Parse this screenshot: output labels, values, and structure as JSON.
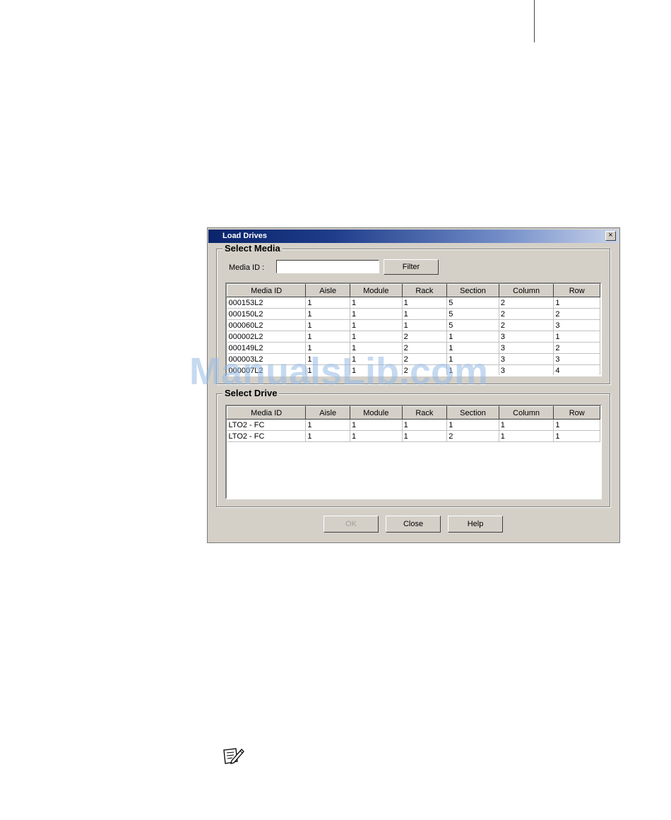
{
  "dialog": {
    "title": "Load Drives",
    "close_glyph": "×"
  },
  "media": {
    "legend": "Select Media",
    "media_id_label": "Media ID :",
    "media_id_value": "",
    "filter_label": "Filter",
    "columns": [
      "Media ID",
      "Aisle",
      "Module",
      "Rack",
      "Section",
      "Column",
      "Row"
    ],
    "rows": [
      [
        "000153L2",
        "1",
        "1",
        "1",
        "5",
        "2",
        "1"
      ],
      [
        "000150L2",
        "1",
        "1",
        "1",
        "5",
        "2",
        "2"
      ],
      [
        "000060L2",
        "1",
        "1",
        "1",
        "5",
        "2",
        "3"
      ],
      [
        "000002L2",
        "1",
        "1",
        "2",
        "1",
        "3",
        "1"
      ],
      [
        "000149L2",
        "1",
        "1",
        "2",
        "1",
        "3",
        "2"
      ],
      [
        "000003L2",
        "1",
        "1",
        "2",
        "1",
        "3",
        "3"
      ],
      [
        "000007L2",
        "1",
        "1",
        "2",
        "1",
        "3",
        "4"
      ]
    ]
  },
  "drive": {
    "legend": "Select Drive",
    "columns": [
      "Media ID",
      "Aisle",
      "Module",
      "Rack",
      "Section",
      "Column",
      "Row"
    ],
    "rows": [
      [
        "LTO2 - FC",
        "1",
        "1",
        "1",
        "1",
        "1",
        "1"
      ],
      [
        "LTO2 - FC",
        "1",
        "1",
        "1",
        "2",
        "1",
        "1"
      ]
    ]
  },
  "buttons": {
    "ok": "OK",
    "close": "Close",
    "help": "Help"
  },
  "watermark": "ManualsLib.com",
  "icons": {
    "note": "note-pencil-icon"
  }
}
